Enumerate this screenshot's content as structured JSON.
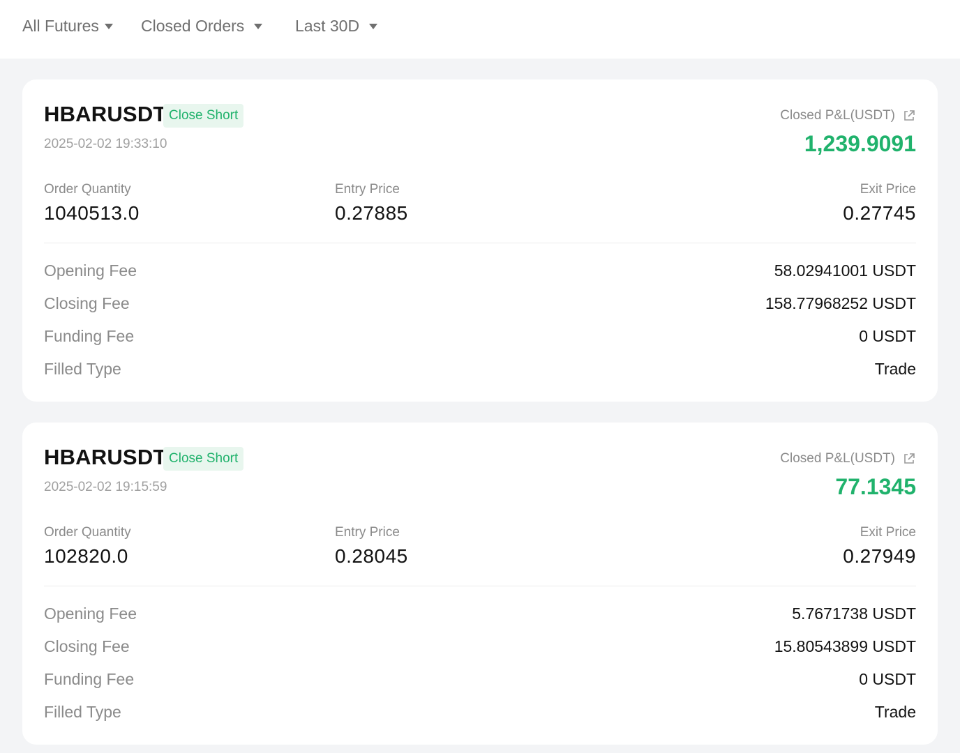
{
  "filters": {
    "market": "All Futures",
    "order_type": "Closed Orders",
    "period": "Last 30D"
  },
  "colors": {
    "profit": "#20b26c",
    "badge_bg": "#e8f6ee",
    "page_bg": "#f3f4f6"
  },
  "labels": {
    "pnl": "Closed P&L(USDT)",
    "order_quantity": "Order Quantity",
    "entry_price": "Entry Price",
    "exit_price": "Exit Price",
    "opening_fee": "Opening Fee",
    "closing_fee": "Closing Fee",
    "funding_fee": "Funding Fee",
    "filled_type": "Filled Type"
  },
  "orders": [
    {
      "symbol": "HBARUSDT",
      "side": "Close Short",
      "time": "2025-02-02 19:33:10",
      "pnl": "1,239.9091",
      "order_quantity": "1040513.0",
      "entry_price": "0.27885",
      "exit_price": "0.27745",
      "opening_fee": "58.02941001 USDT",
      "closing_fee": "158.77968252 USDT",
      "funding_fee": "0 USDT",
      "filled_type": "Trade"
    },
    {
      "symbol": "HBARUSDT",
      "side": "Close Short",
      "time": "2025-02-02 19:15:59",
      "pnl": "77.1345",
      "order_quantity": "102820.0",
      "entry_price": "0.28045",
      "exit_price": "0.27949",
      "opening_fee": "5.7671738 USDT",
      "closing_fee": "15.80543899 USDT",
      "funding_fee": "0 USDT",
      "filled_type": "Trade"
    }
  ]
}
